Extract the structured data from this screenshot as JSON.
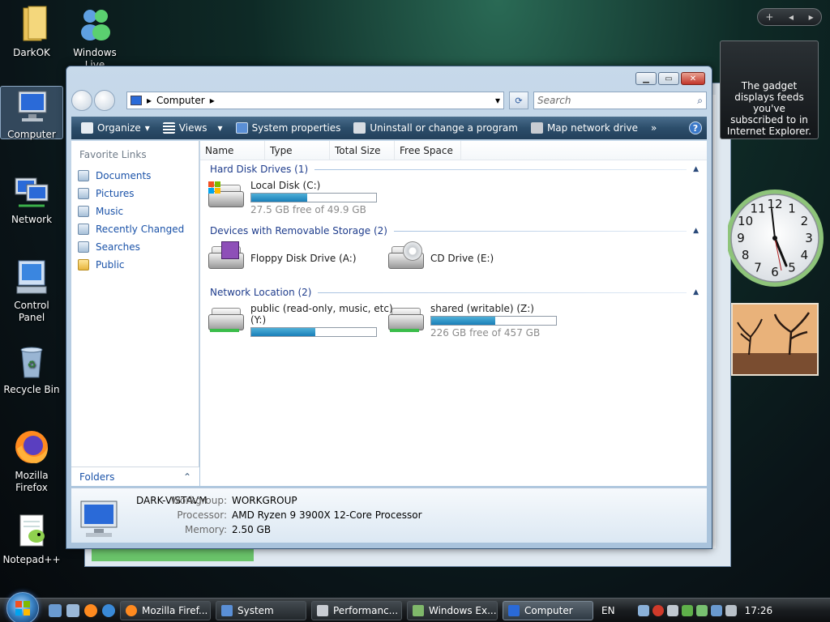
{
  "desktop": {
    "icons": [
      {
        "label": "DarkOK"
      },
      {
        "label": "Windows Live Messenger"
      },
      {
        "label": "Computer"
      },
      {
        "label": "Network"
      },
      {
        "label": "Control Panel"
      },
      {
        "label": "Recycle Bin"
      },
      {
        "label": "Mozilla Firefox"
      },
      {
        "label": "Notepad++"
      }
    ]
  },
  "window": {
    "breadcrumb": "Computer",
    "search_placeholder": "Search",
    "toolbar": {
      "organize": "Organize",
      "views": "Views",
      "system_properties": "System properties",
      "uninstall": "Uninstall or change a program",
      "map_drive": "Map network drive",
      "more": "»",
      "help": "?"
    },
    "nav": {
      "heading": "Favorite Links",
      "links": [
        "Documents",
        "Pictures",
        "Music",
        "Recently Changed",
        "Searches",
        "Public"
      ],
      "folders": "Folders"
    },
    "columns": [
      "Name",
      "Type",
      "Total Size",
      "Free Space"
    ],
    "groups": {
      "hdd": "Hard Disk Drives (1)",
      "removable": "Devices with Removable Storage (2)",
      "network": "Network Location (2)"
    },
    "drives": {
      "c": {
        "name": "Local Disk (C:)",
        "free": "27.5 GB free of 49.9 GB",
        "used_fraction": 0.45
      },
      "a": {
        "name": "Floppy Disk Drive (A:)"
      },
      "e": {
        "name": "CD Drive (E:)"
      },
      "y": {
        "name": "public (read-only, music, etc)",
        "name2": "(Y:)",
        "used_fraction": 0.51
      },
      "z": {
        "name": "shared (writable) (Z:)",
        "free": "226 GB free of 457 GB",
        "used_fraction": 0.51
      }
    },
    "details": {
      "computer_name": "DARK-VISTAVM",
      "workgroup_label": "Workgroup:",
      "workgroup": "WORKGROUP",
      "processor_label": "Processor:",
      "processor": "AMD Ryzen 9 3900X 12-Core Processor",
      "memory_label": "Memory:",
      "memory": "2.50 GB"
    }
  },
  "gadgets": {
    "rss_text": "The gadget displays feeds you've subscribed to in Internet Explorer.",
    "sidebar_add": "+",
    "clock_numbers": [
      "12",
      "1",
      "2",
      "3",
      "4",
      "5",
      "6",
      "7",
      "8",
      "9",
      "10",
      "11"
    ]
  },
  "taskbar": {
    "buttons": [
      "Mozilla Firef...",
      "System",
      "Performanc...",
      "Windows Ex...",
      "Computer"
    ],
    "lang": "EN",
    "time": "17:26"
  },
  "colors": {
    "accent_link": "#1a52a8",
    "group_header": "#1e3c8c",
    "bar_fill": "#1a7fb8"
  }
}
